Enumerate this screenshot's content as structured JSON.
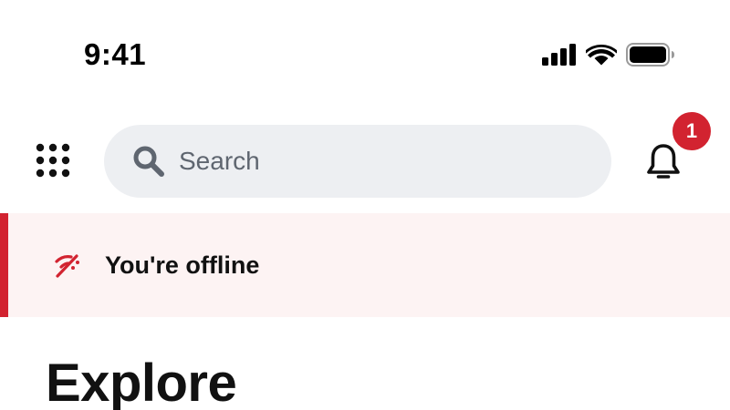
{
  "status_bar": {
    "time": "9:41",
    "icons": [
      "cellular-signal-icon",
      "wifi-icon",
      "battery-icon"
    ]
  },
  "header": {
    "menu_icon": "grid-menu-icon",
    "search": {
      "icon": "search-icon",
      "placeholder": "Search"
    },
    "notifications": {
      "icon": "bell-icon",
      "badge_count": "1"
    }
  },
  "offline_banner": {
    "icon": "offline-icon",
    "message": "You're offline"
  },
  "main": {
    "title": "Explore"
  },
  "colors": {
    "accent": "#d22330",
    "search_background": "#edeff2",
    "banner_background": "#fdf3f3",
    "text_primary": "#111111",
    "placeholder": "#5f6670"
  }
}
